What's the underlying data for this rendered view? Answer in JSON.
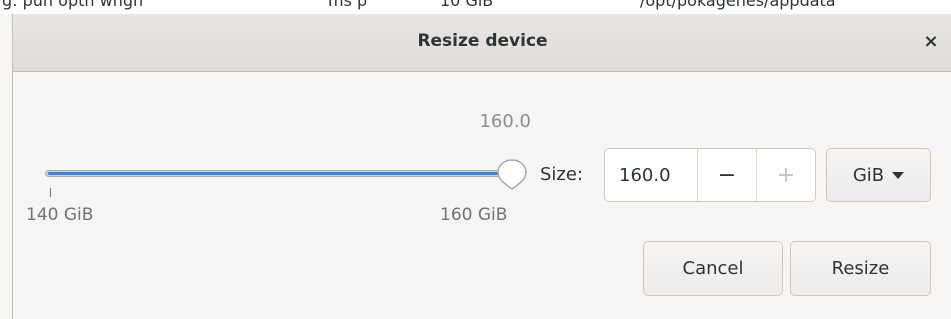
{
  "background_window": {
    "fragments": [
      "g:  pun optn  wngn",
      "ms  p",
      "10 GiB",
      "/opt/pokagenes/appdata"
    ]
  },
  "dialog": {
    "title": "Resize device",
    "close_label": "×",
    "slider": {
      "value_label": "160.0",
      "min_label": "140 GiB",
      "max_label": "160 GiB",
      "min": 140,
      "max": 160,
      "value": 160
    },
    "size_label": "Size:",
    "size_value": "160.0",
    "decrement_label": "−",
    "increment_label": "+",
    "unit_label": "GiB",
    "cancel_label": "Cancel",
    "resize_label": "Resize",
    "colors": {
      "accent": "#3584e4"
    }
  }
}
